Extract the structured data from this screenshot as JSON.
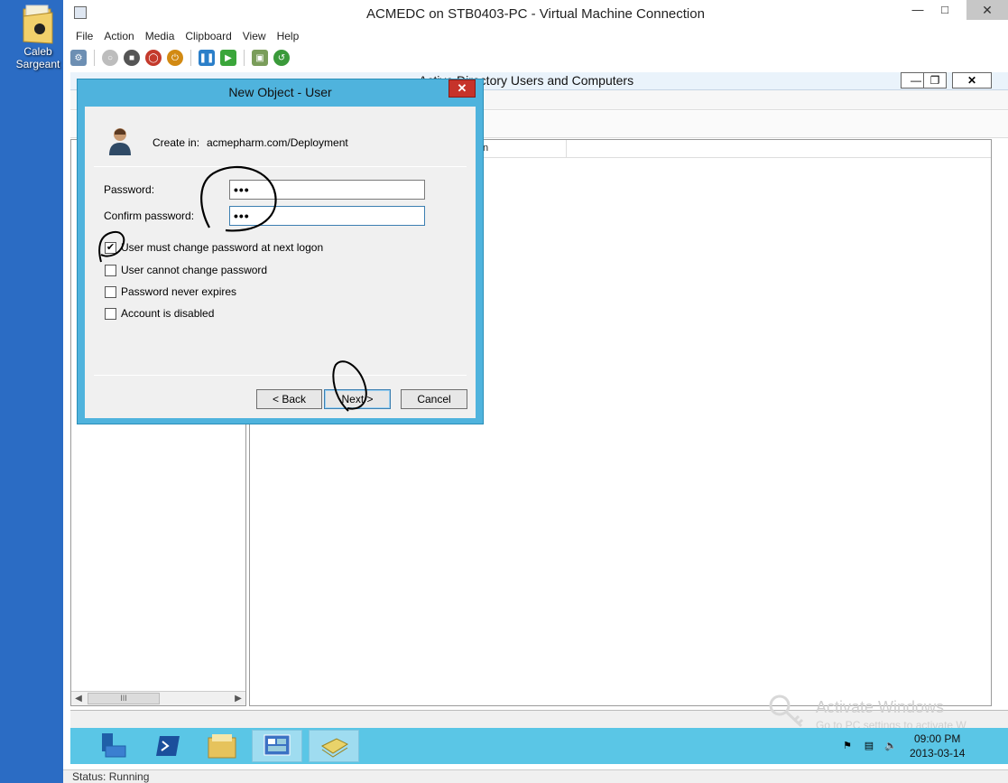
{
  "host": {
    "desktop_icon_label": "Caleb Sargeant"
  },
  "vm_window": {
    "title": "ACMEDC on STB0403-PC - Virtual Machine Connection",
    "menu": [
      "File",
      "Action",
      "Media",
      "Clipboard",
      "View",
      "Help"
    ],
    "status": "Status: Running"
  },
  "ad_window": {
    "title": "Active Directory Users and Computers",
    "column_header_partial": "n",
    "scroll_thumb": "III"
  },
  "dialog": {
    "title": "New Object - User",
    "create_in_label": "Create in:",
    "create_in_value": "acmepharm.com/Deployment",
    "password_label": "Password:",
    "password_value": "•••",
    "confirm_label": "Confirm password:",
    "confirm_value": "•••",
    "checkboxes": [
      {
        "label": "User must change password at next logon",
        "checked": true
      },
      {
        "label": "User cannot change password",
        "checked": false
      },
      {
        "label": "Password never expires",
        "checked": false
      },
      {
        "label": "Account is disabled",
        "checked": false
      }
    ],
    "back_label": "< Back",
    "next_label": "Next >",
    "cancel_label": "Cancel"
  },
  "guest_taskbar": {
    "time": "09:00 PM",
    "date": "2013-03-14"
  },
  "watermark": {
    "line1": "Activate Windows",
    "line2": "Go to PC settings to activate W"
  }
}
